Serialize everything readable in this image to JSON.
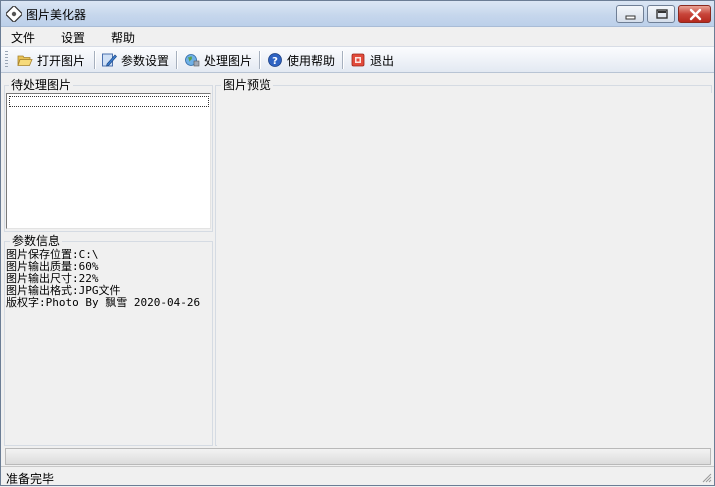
{
  "window": {
    "title": "图片美化器"
  },
  "menu": {
    "items": [
      "文件",
      "设置",
      "帮助"
    ]
  },
  "toolbar": {
    "buttons": [
      {
        "label": "打开图片",
        "icon": "folder-open-icon"
      },
      {
        "label": "参数设置",
        "icon": "settings-edit-icon"
      },
      {
        "label": "处理图片",
        "icon": "process-globe-icon"
      },
      {
        "label": "使用帮助",
        "icon": "help-icon"
      },
      {
        "label": "退出",
        "icon": "exit-icon"
      }
    ]
  },
  "panels": {
    "pending_label": "待处理图片",
    "params_label": "参数信息",
    "preview_label": "图片预览"
  },
  "params": {
    "lines": [
      "图片保存位置:C:\\",
      "图片输出质量:60%",
      "图片输出尺寸:22%",
      "图片输出格式:JPG文件",
      "版权字:Photo By 飘雪 2020-04-26"
    ]
  },
  "status": {
    "text": "准备完毕"
  },
  "colors": {
    "close_button": "#c8453a",
    "titlebar": "#c5d6ec"
  }
}
